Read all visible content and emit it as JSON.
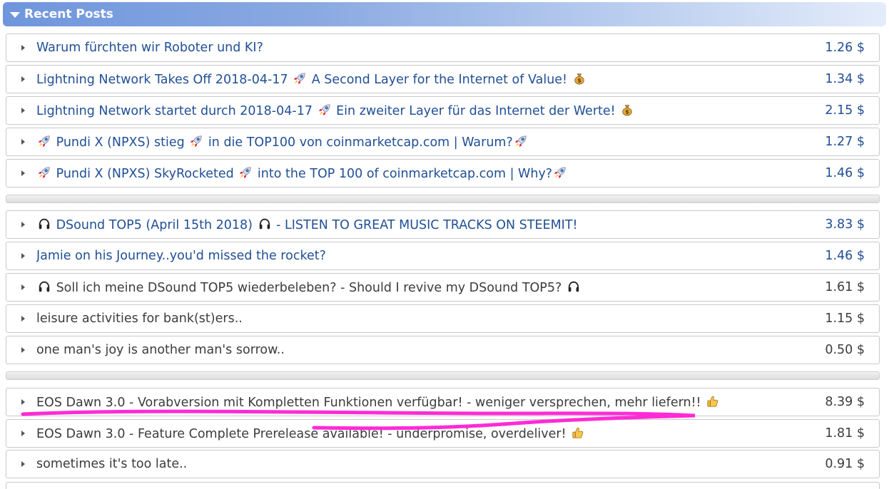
{
  "header": {
    "title": "Recent Posts"
  },
  "colors": {
    "link": "#214f96",
    "visited": "#3c3c3c",
    "highlight": "#ff2bd6"
  },
  "posts": [
    {
      "t1": "Warum fürchten wir Roboter und KI?",
      "v": "1.26 $"
    },
    {
      "t1": "Lightning Network Takes Off 2018-04-17",
      "t2": "A Second Layer for the Internet of Value!",
      "v": "1.34 $"
    },
    {
      "t1": "Lightning Network startet durch 2018-04-17",
      "t2": "Ein zweiter Layer für das Internet der Werte!",
      "v": "2.15 $"
    },
    {
      "t1": "Pundi X (NPXS) stieg",
      "t2": "in die TOP100 von coinmarketcap.com | Warum?",
      "v": "1.27 $"
    },
    {
      "t1": "Pundi X (NPXS) SkyRocketed",
      "t2": "into the TOP 100 of coinmarketcap.com | Why?",
      "v": "1.46 $"
    },
    {
      "t1": "DSound TOP5 (April 15th 2018)",
      "t2": "- LISTEN TO GREAT MUSIC TRACKS ON STEEMIT!",
      "v": "3.83 $"
    },
    {
      "t1": "Jamie on his Journey..you'd missed the rocket?",
      "v": "1.46 $"
    },
    {
      "t1": "Soll ich meine DSound TOP5 wiederbeleben? - Should I revive my DSound TOP5?",
      "v": "1.61 $"
    },
    {
      "t1": "leisure activities for bank(st)ers..",
      "v": "1.15 $"
    },
    {
      "t1": "one man's joy is another man's sorrow..",
      "v": "0.50 $"
    },
    {
      "t1": "EOS Dawn 3.0 - Vorabversion mit Kompletten Funktionen verfügbar! - weniger versprechen, mehr liefern!!",
      "v": "8.39 $"
    },
    {
      "t1": "EOS Dawn 3.0 - Feature Complete Prerelease available! - underpromise, overdeliver!",
      "v": "1.81 $"
    },
    {
      "t1": "sometimes it's too late..",
      "v": "0.91 $"
    }
  ],
  "icons": [
    "rocket-icon",
    "money-bag-icon",
    "headphones-icon",
    "thumbs-up-icon"
  ]
}
